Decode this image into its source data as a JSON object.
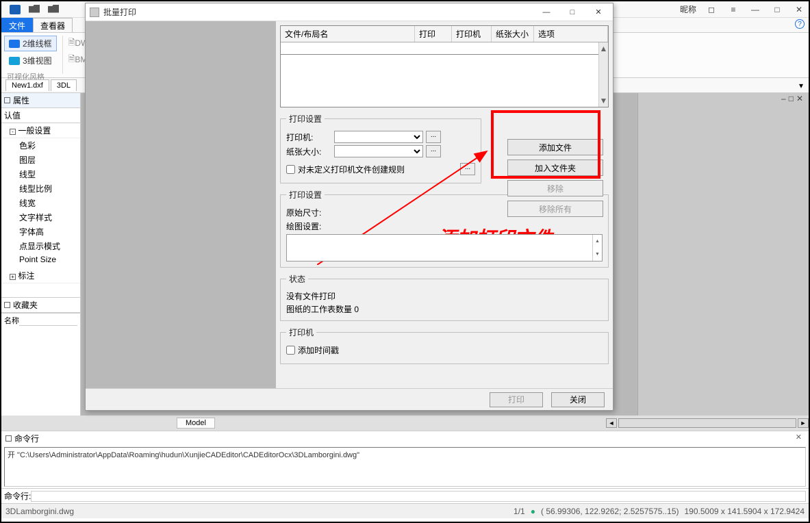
{
  "app": {
    "nickname": "昵称",
    "tabs": {
      "file": "文件",
      "viewer": "查看器"
    },
    "help_icon": "?"
  },
  "toolbar": {
    "btn_2d": "2维线框",
    "btn_3d": "3维视图",
    "caption": "可视化风格",
    "side_label_1": "DWG",
    "side_label_2": "BMP"
  },
  "doc_tabs": {
    "t1": "New1.dxf",
    "t2": "3DL"
  },
  "properties": {
    "title": "属性",
    "default": "认值",
    "group_general": "一般设置",
    "items": {
      "color": "色彩",
      "layer": "图层",
      "linetype": "线型",
      "linescale": "线型比例",
      "lineweight": "线宽",
      "textstyle": "文字样式",
      "textheight": "字体高",
      "pointstyle": "点显示模式",
      "pointsize": "Point Size"
    },
    "group_annot": "标注",
    "fav_title": "收藏夹",
    "name_label": "名称"
  },
  "dialog": {
    "title": "批量打印",
    "table": {
      "col_file": "文件/布局名",
      "col_print": "打印",
      "col_printer": "打印机",
      "col_paper": "纸张大小",
      "col_options": "选项"
    },
    "print_settings": {
      "legend": "打印设置",
      "printer": "打印机:",
      "paper": "纸张大小:",
      "rule_checkbox": "对未定义打印机文件创建规则"
    },
    "buttons": {
      "add_file": "添加文件",
      "add_folder": "加入文件夹",
      "remove": "移除",
      "remove_all": "移除所有"
    },
    "draw_settings": {
      "legend": "打印设置",
      "orig_size": "原始尺寸:",
      "draw_cfg": "绘图设置:"
    },
    "status": {
      "legend": "状态",
      "no_file": "没有文件打印",
      "sheets": "图纸的工作表数量 0"
    },
    "printer_group": {
      "legend": "打印机",
      "timestamp_chk": "添加时间戳"
    },
    "footer": {
      "print": "打印",
      "close": "关闭"
    },
    "annotation": "添加打印文件"
  },
  "bottom": {
    "model_tab": "Model",
    "cmd_title": "命令行",
    "cmd_output": "开 \"C:\\Users\\Administrator\\AppData\\Roaming\\hudun\\XunjieCADEditor\\CADEditorOcx\\3DLamborgini.dwg\"",
    "cmd_prompt": "命令行:",
    "status_left": "3DLamborgini.dwg",
    "status_mid": "1/1",
    "status_coords": "( 56.99306,  122.9262;  2.5257575..15)",
    "status_right": "190.5009 x 141.5904 x 172.9424"
  }
}
